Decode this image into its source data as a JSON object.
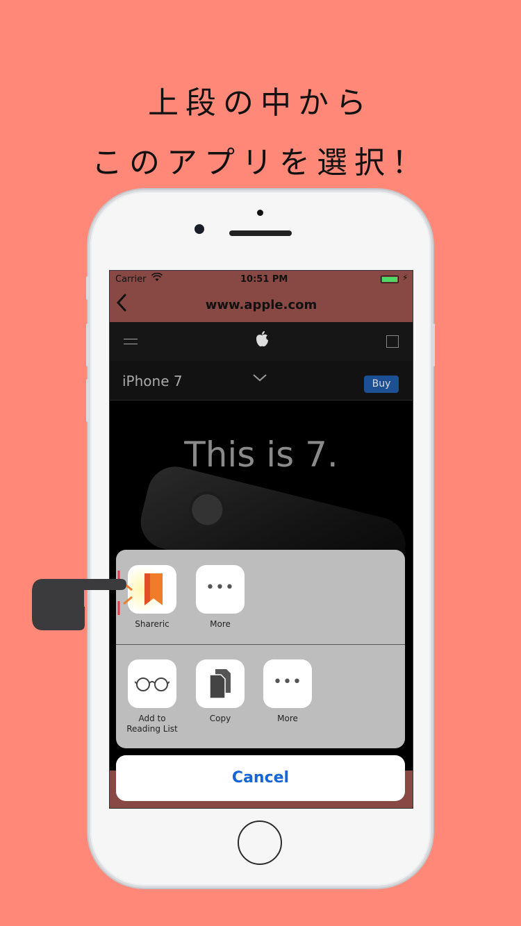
{
  "headline": {
    "line1": "上段の中から",
    "line2": "このアプリを選択！"
  },
  "statusbar": {
    "carrier": "Carrier",
    "time": "10:51 PM"
  },
  "navbar": {
    "back_icon": "chevron-left-icon",
    "url": "www.apple.com"
  },
  "web": {
    "product_name": "iPhone 7",
    "buy_label": "Buy",
    "hero_text": "This is 7."
  },
  "share_sheet": {
    "app_row": [
      {
        "label": "Shareric",
        "icon": "bookmark-icon"
      },
      {
        "label": "More",
        "icon": "more-icon"
      }
    ],
    "action_row": [
      {
        "label": "Add to\nReading List",
        "icon": "glasses-icon"
      },
      {
        "label": "Copy",
        "icon": "copy-icon"
      },
      {
        "label": "More",
        "icon": "more-icon"
      }
    ],
    "cancel_label": "Cancel"
  },
  "colors": {
    "background": "#ff8878",
    "navbar": "#884843",
    "accent_blue": "#1565d8",
    "app_icon_orange": "#f07c2a"
  }
}
